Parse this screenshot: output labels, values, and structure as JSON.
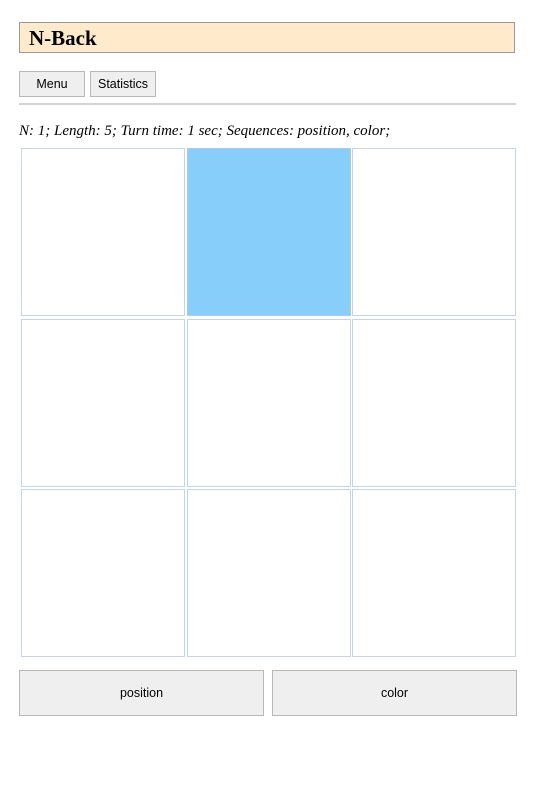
{
  "header": {
    "title": "N-Back"
  },
  "nav": {
    "menu_label": "Menu",
    "statistics_label": "Statistics"
  },
  "game": {
    "settings_text": "N: 1; Length: 5; Turn time: 1 sec; Sequences: position, color;",
    "active_cell": "top-center",
    "active_color": "#87cefa",
    "grid_cells": [
      {
        "position": "top-left",
        "active": false
      },
      {
        "position": "top-center",
        "active": true
      },
      {
        "position": "top-right",
        "active": false
      },
      {
        "position": "middle-left",
        "active": false
      },
      {
        "position": "middle-center",
        "active": false
      },
      {
        "position": "middle-right",
        "active": false
      },
      {
        "position": "bottom-left",
        "active": false
      },
      {
        "position": "bottom-center",
        "active": false
      },
      {
        "position": "bottom-right",
        "active": false
      }
    ]
  },
  "controls": {
    "position_label": "position",
    "color_label": "color"
  }
}
